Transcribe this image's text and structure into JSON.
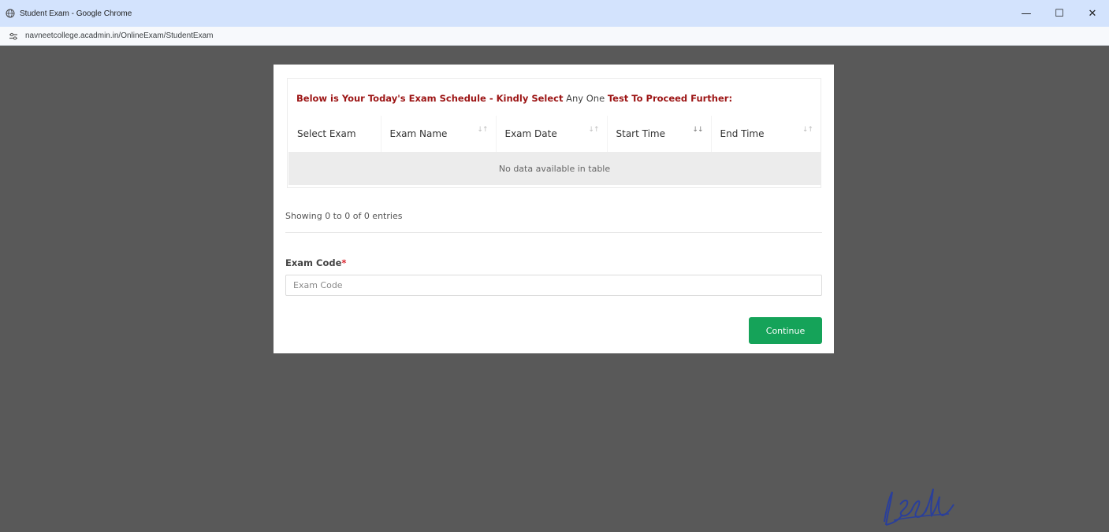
{
  "window": {
    "title": "Student Exam - Google Chrome",
    "url": "navneetcollege.acadmin.in/OnlineExam/StudentExam",
    "controls": {
      "minimize": "—",
      "maximize": "☐",
      "close": "✕"
    }
  },
  "schedule": {
    "heading_part1": "Below is Your Today's Exam Schedule - Kindly Select",
    "heading_part2": " Any One ",
    "heading_part3": "Test To Proceed Further:",
    "columns": [
      "Select Exam",
      "Exam Name",
      "Exam Date",
      "Start Time",
      "End Time"
    ],
    "empty_message": "No data available in table",
    "entries_info": "Showing 0 to 0 of 0 entries"
  },
  "exam_code": {
    "label": "Exam Code",
    "required_mark": "*",
    "placeholder": "Exam Code",
    "value": ""
  },
  "continue_label": "Continue",
  "colors": {
    "heading_red": "#9c1414",
    "button_green": "#15a359",
    "backdrop": "#595959"
  }
}
